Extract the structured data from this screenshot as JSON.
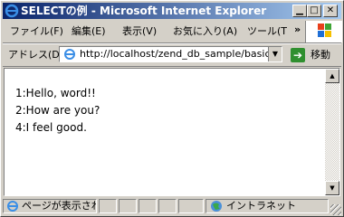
{
  "window": {
    "title": "SELECTの例 - Microsoft Internet Explorer"
  },
  "menu": {
    "items": [
      "ファイル(F)",
      "編集(E)",
      "表示(V)",
      "お気に入り(A)",
      "ツール(T"
    ],
    "more": "»"
  },
  "address": {
    "label": "アドレス(D)",
    "url": "http://localhost/zend_db_sample/basic_s",
    "go_label": "移動"
  },
  "content": {
    "lines": [
      "1:Hello, word!!",
      "2:How are you?",
      "4:I feel good."
    ]
  },
  "status": {
    "text": "ページが表示され",
    "zone": "イントラネット"
  },
  "colors": {
    "titlebar_start": "#0a246a",
    "titlebar_end": "#a6caf0",
    "chrome": "#d4d0c8",
    "go_green": "#2f8f2f"
  }
}
